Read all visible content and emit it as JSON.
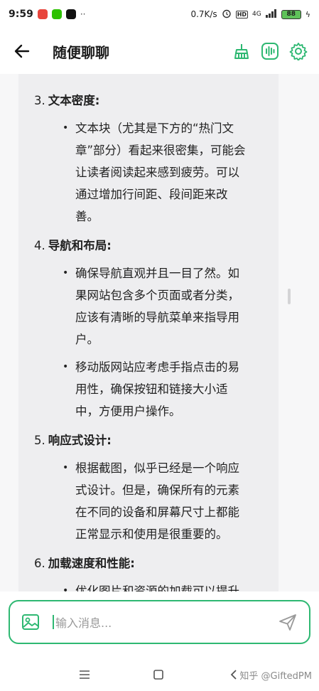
{
  "status_bar": {
    "time": "9:59",
    "network_speed": "0.7K/s",
    "network_type": "4G",
    "battery": "88",
    "icons": [
      "app-red-icon",
      "wechat-icon",
      "tiktok-icon",
      "more-dots-icon",
      "alarm-icon",
      "hd-icon",
      "signal-icon",
      "battery-icon",
      "charging-icon"
    ]
  },
  "header": {
    "title": "随便聊聊",
    "accent_color": "#2eb872"
  },
  "content": {
    "sections": [
      {
        "num": "3.",
        "title": "文本密度:",
        "bullets": [
          "文本块（尤其是下方的“热门文\n章”部分）看起来很密集，可能会\n让读者阅读起来感到疲劳。可以\n通过增加行间距、段间距来改\n善。"
        ]
      },
      {
        "num": "4.",
        "title": "导航和布局:",
        "bullets": [
          "确保导航直观并且一目了然。如\n果网站包含多个页面或者分类，\n应该有清晰的导航菜单来指导用\n户。",
          "移动版网站应考虑手指点击的易\n用性，确保按钮和链接大小适\n中，方便用户操作。"
        ]
      },
      {
        "num": "5.",
        "title": "响应式设计:",
        "bullets": [
          "根据截图，似乎已经是一个响应\n式设计。但是，确保所有的元素\n在不同的设备和屏幕尺寸上都能\n正常显示和使用是很重要的。"
        ]
      },
      {
        "num": "6.",
        "title": "加载速度和性能:",
        "bullets": [
          "优化图片和资源的加载可以提升\n网站性能，减少用户等待时间。"
        ]
      }
    ]
  },
  "input": {
    "placeholder": "输入消息..."
  },
  "watermark": "知乎 @GiftedPM"
}
